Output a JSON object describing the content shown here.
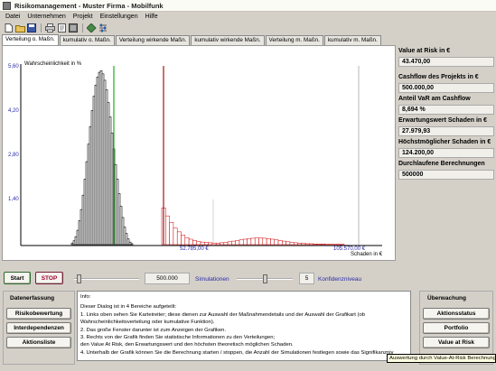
{
  "window": {
    "title": "Risikomanagement - Muster Firma - Mobilfunk"
  },
  "menu": [
    "Datei",
    "Unternehmen",
    "Projekt",
    "Einstellungen",
    "Hilfe"
  ],
  "toolbar_icons": [
    "new-file-icon",
    "open-folder-icon",
    "save-icon",
    "print-icon",
    "preview-icon",
    "export-icon",
    "edit-icon",
    "settings-icon"
  ],
  "tabs": [
    "Verteilung o. Maßn.",
    "kumulativ o. Maßn.",
    "Verteilung wirkende Maßn.",
    "kumulativ wirkende Maßn.",
    "Verteilung m. Maßn.",
    "kumulativ m. Maßn."
  ],
  "chart_data": {
    "type": "bar",
    "ylabel": "Wahrscheinlichkeit in %",
    "xlabel": "Schaden in €",
    "y_ticks": [
      "5,60",
      "4,20",
      "2,80",
      "1,40"
    ],
    "x_markers": [
      "52.785,00 €",
      "105.570,00 €"
    ],
    "ylim": [
      0,
      5.6
    ],
    "series": [
      {
        "color": "#000000",
        "values": [
          0.05,
          0.12,
          0.25,
          0.45,
          0.75,
          1.1,
          1.55,
          2.05,
          2.6,
          3.15,
          3.7,
          4.2,
          4.65,
          5.0,
          5.25,
          5.4,
          5.45,
          5.35,
          5.15,
          4.85,
          4.45,
          4.0,
          3.5,
          3.0,
          2.5,
          2.05,
          1.6,
          1.2,
          0.85,
          0.55,
          0.35,
          0.18,
          0.08,
          0.03
        ]
      },
      {
        "color": "#cc0000",
        "values": [
          1.15,
          0.9,
          0.7,
          0.52,
          0.4,
          0.3,
          0.22,
          0.17,
          0.13,
          0.1,
          0.08,
          0.07,
          0.06,
          0.05,
          0.05,
          0.06,
          0.07,
          0.09,
          0.11,
          0.13,
          0.15,
          0.17,
          0.19,
          0.2,
          0.21,
          0.21,
          0.2,
          0.19,
          0.17,
          0.15,
          0.13,
          0.11,
          0.09,
          0.07,
          0.06,
          0.05,
          0.04,
          0.03,
          0.03,
          0.02,
          0.02,
          0.02,
          0.01,
          0.01,
          0.01,
          0.01,
          0.01
        ]
      }
    ],
    "vlines": [
      {
        "name": "expected-loss-line",
        "color": "#22aa22"
      },
      {
        "name": "value-at-risk-line",
        "color": "#aa1111"
      }
    ]
  },
  "kpis": [
    {
      "label": "Value at Risk in €",
      "value": "43.470,00"
    },
    {
      "label": "Cashflow des Projekts in €",
      "value": "500.000,00"
    },
    {
      "label": "Anteil VaR am Cashflow",
      "value": "8,694 %"
    },
    {
      "label": "Erwartungswert Schaden in €",
      "value": "27.979,93"
    },
    {
      "label": "Höchstmöglicher Schaden in €",
      "value": "124.200,00"
    },
    {
      "label": "Durchlaufene Berechnungen",
      "value": "500000"
    }
  ],
  "controls": {
    "start": "Start",
    "stop": "STOP",
    "simulations_value": "500.000",
    "simulations_label": "Simulationen",
    "confidence_value": "5",
    "confidence_label": "Konfidenzniveau",
    "simulations_slider_fraction": 0.05,
    "confidence_slider_fraction": 0.5
  },
  "datenerfassung": {
    "title": "Datenerfassung",
    "buttons": [
      "Risikobewertung",
      "Interdependenzen",
      "Aktionsliste"
    ]
  },
  "info": {
    "title": "Info:",
    "lines": [
      "Dieser Dialog ist in 4 Bereiche aufgeteilt:",
      "1. Links oben sehen Sie Karteireiter; diese dienen zur Auswahl der Maßnahmendetails und der Auswahl der Grafikart (ob",
      "Wahrscheinlichkeitsverteilung oder kumulative Funktion).",
      "2. Das große Fenster darunter ist zum Anzeigen der Grafiken.",
      " 3. Rechts von der Grafik finden Sie statistische Informationen zu den Verteilungen;",
      " den Value At Risk, den Erwartungswert und den höchsten theoretisch möglichen Schaden.",
      "4. Unterhalb der Grafik können Sie die Berechnung starten / stoppen, die Anzahl der Simulationen festlegen sowie das Signifikanzniv"
    ]
  },
  "ueberwachung": {
    "title": "Überwachung",
    "buttons": [
      "Aktionsstatus",
      "Portfolio",
      "Value at Risk"
    ]
  },
  "tooltip": "Auswertung durch Value-At-Risk Berechnung"
}
